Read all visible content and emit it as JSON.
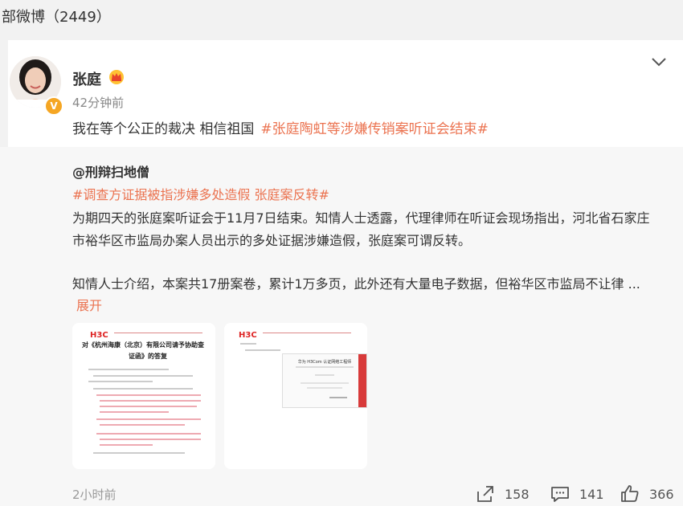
{
  "topbar": {
    "title": "部微博（2449）"
  },
  "post": {
    "username": "张庭",
    "time": "42分钟前",
    "text": "我在等个公正的裁决 相信祖国",
    "hashtag": "#张庭陶虹等涉嫌传销案听证会结束#"
  },
  "repost": {
    "author": "@刑辩扫地僧",
    "hashtag": "#调查方证据被指涉嫌多处造假 张庭案反转#",
    "lines": [
      "为期四天的张庭案听证会于11月7日结束。知情人士透露，代理律师在听证会现场指出，河北省石家庄",
      "市裕华区市监局办案人员出示的多处证据涉嫌造假，张庭案可谓反转。",
      "知情人士介绍，本案共17册案卷，累计1万多页，此外还有大量电子数据，但裕华区市监局不让律  ..."
    ],
    "expand_label": "展开",
    "images": [
      {
        "logo": "H3C",
        "title_line1": "对《杭州海康（北京）有限公司请予协助查",
        "title_line2": "证函》的答复"
      },
      {
        "logo": "H3C",
        "cert_title": "华为 H3Com 认证网络工程师"
      }
    ],
    "time": "2小时前"
  },
  "actions": {
    "share_count": "158",
    "comment_count": "141",
    "like_count": "366"
  }
}
